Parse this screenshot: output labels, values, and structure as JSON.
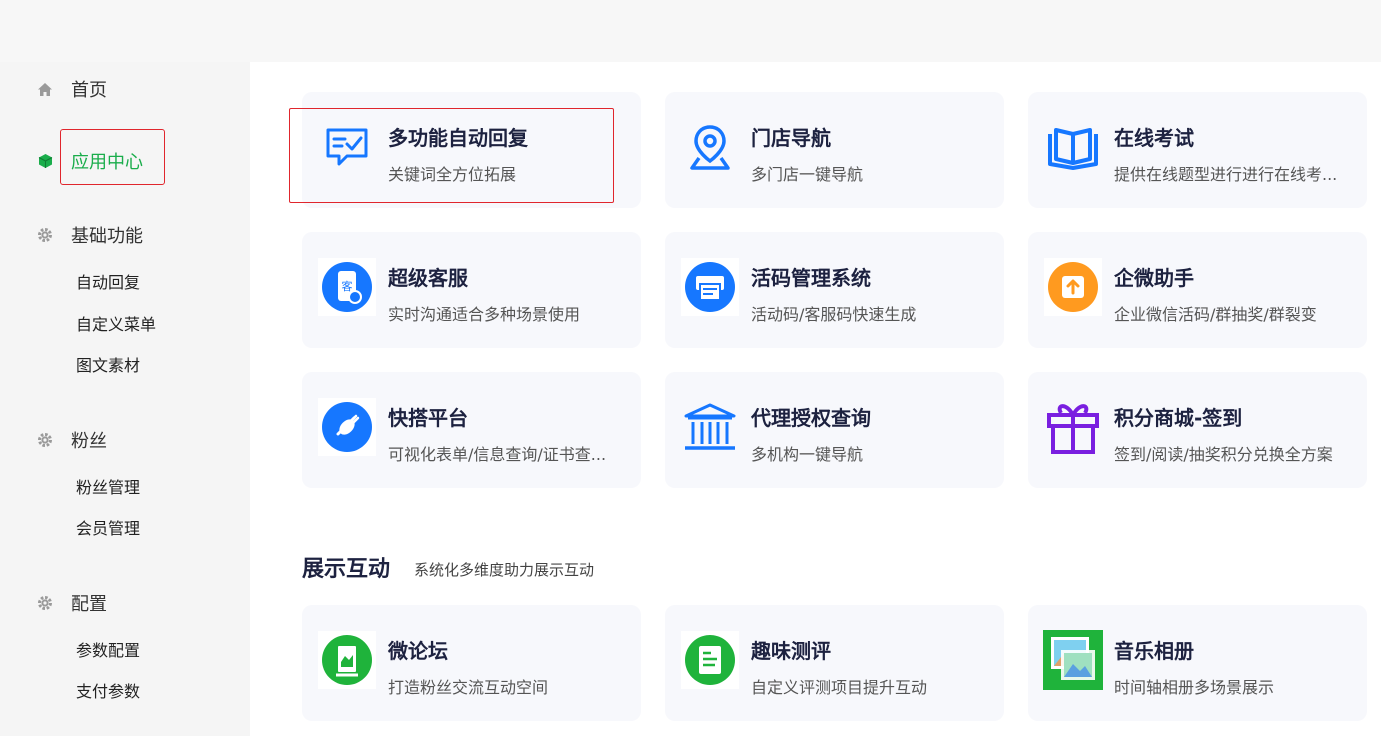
{
  "sidebar": {
    "home": "首页",
    "app_center": "应用中心",
    "basic": {
      "label": "基础功能",
      "items": [
        "自动回复",
        "自定义菜单",
        "图文素材"
      ]
    },
    "fans": {
      "label": "粉丝",
      "items": [
        "粉丝管理",
        "会员管理"
      ]
    },
    "config": {
      "label": "配置",
      "items": [
        "参数配置",
        "支付参数"
      ]
    }
  },
  "cards": [
    {
      "title": "多功能自动回复",
      "desc": "关键词全方位拓展",
      "icon": "chat-check-icon"
    },
    {
      "title": "门店导航",
      "desc": "多门店一键导航",
      "icon": "location-pin-icon"
    },
    {
      "title": "在线考试",
      "desc": "提供在线题型进行进行在线考...",
      "icon": "book-open-icon"
    },
    {
      "title": "超级客服",
      "desc": "实时沟通适合多种场景使用",
      "icon": "customer-service-icon"
    },
    {
      "title": "活码管理系统",
      "desc": "活动码/客服码快速生成",
      "icon": "printer-icon"
    },
    {
      "title": "企微助手",
      "desc": "企业微信活码/群抽奖/群裂变",
      "icon": "upload-icon"
    },
    {
      "title": "快搭平台",
      "desc": "可视化表单/信息查询/证书查...",
      "icon": "plug-icon"
    },
    {
      "title": "代理授权查询",
      "desc": "多机构一键导航",
      "icon": "institution-icon"
    },
    {
      "title": "积分商城-签到",
      "desc": "签到/阅读/抽奖积分兑换全方案",
      "icon": "gift-icon"
    },
    {
      "title": "微论坛",
      "desc": "打造粉丝交流互动空间",
      "icon": "forum-icon"
    },
    {
      "title": "趣味测评",
      "desc": "自定义评测项目提升互动",
      "icon": "survey-icon"
    },
    {
      "title": "音乐相册",
      "desc": "时间轴相册多场景展示",
      "icon": "photo-album-icon"
    }
  ],
  "section2": {
    "title": "展示互动",
    "subtitle": "系统化多维度助力展示互动"
  },
  "colors": {
    "active": "#1aad4b",
    "highlight": "#e0262d",
    "blue": "#1677ff",
    "orange": "#ff9a1f",
    "purple": "#7a1fe0",
    "green": "#1fb33b"
  }
}
